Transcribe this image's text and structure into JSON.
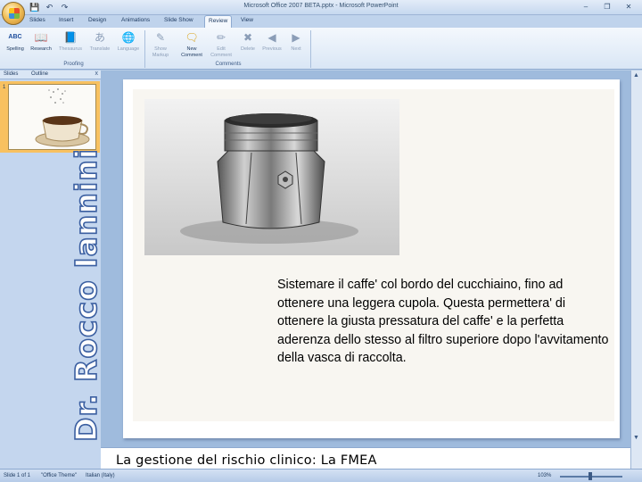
{
  "window": {
    "title": "Microsoft Office 2007 BETA.pptx - Microsoft PowerPoint",
    "controls": [
      "–",
      "❐",
      "✕"
    ]
  },
  "quick_access": {
    "save_icon": "💾",
    "undo_icon": "↶",
    "redo_icon": "↷"
  },
  "tabs": [
    "Slides",
    "Insert",
    "Design",
    "Animations",
    "Slide Show",
    "Review",
    "View"
  ],
  "ribbon": {
    "proofing": {
      "label": "Proofing",
      "buttons": [
        {
          "label": "Spelling",
          "icon": "ABC"
        },
        {
          "label": "Research",
          "icon": "📖"
        },
        {
          "label": "Thesaurus",
          "icon": "📘"
        },
        {
          "label": "Translate",
          "icon": "あ"
        },
        {
          "label": "Language",
          "icon": "🌐"
        }
      ]
    },
    "comments": {
      "label": "Comments",
      "buttons": [
        {
          "label": "Show Markup",
          "icon": "✎"
        },
        {
          "label": "New Comment",
          "icon": "🗨"
        },
        {
          "label": "Edit Comment",
          "icon": "✏"
        },
        {
          "label": "Delete",
          "icon": "✖"
        },
        {
          "label": "Previous",
          "icon": "◀"
        },
        {
          "label": "Next",
          "icon": "▶"
        }
      ]
    }
  },
  "left_panel": {
    "tabs": [
      "Slides",
      "Outline"
    ],
    "close": "x",
    "slide_number": "1"
  },
  "author_vertical": "Dr. Rocco Iannini",
  "slide": {
    "body": "Sistemare il caffe' col bordo del cucchiaino, fino ad ottenere una leggera cupola. Questa permettera' di ottenere la giusta pressatura del caffe' e la perfetta aderenza dello stesso al filtro superiore dopo l'avvitamento della vasca di raccolta."
  },
  "notes": {
    "text": "La gestione del rischio clinico: La FMEA"
  },
  "status": {
    "slide": "Slide 1 of 1",
    "theme": "\"Office Theme\"",
    "language": "Italian (Italy)",
    "zoom": "103%"
  }
}
